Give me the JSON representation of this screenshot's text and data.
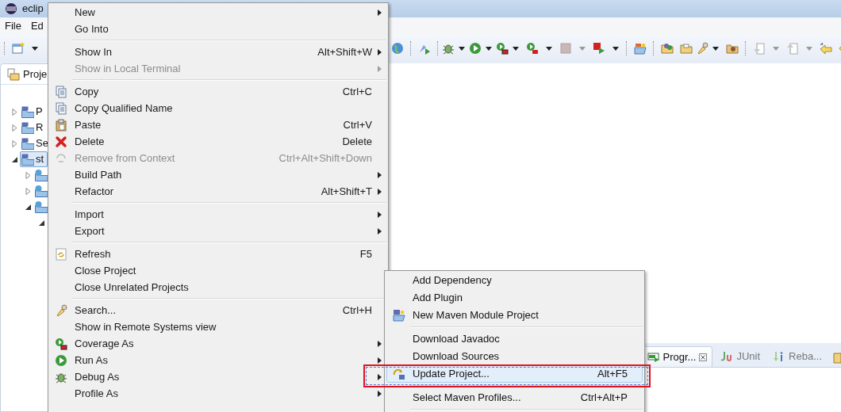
{
  "window": {
    "title": "eclip"
  },
  "menu_bar": [
    "File",
    "Ed"
  ],
  "project_explorer": {
    "tab": "Proje",
    "tree": [
      {
        "label": "P",
        "expanded": false,
        "selected": false
      },
      {
        "label": "R",
        "expanded": false,
        "selected": false
      },
      {
        "label": "Se",
        "expanded": false,
        "selected": false
      },
      {
        "label": "st",
        "expanded": true,
        "selected": true,
        "children": [
          {
            "expanded": false
          },
          {
            "expanded": false
          },
          {
            "expanded": true,
            "children": [
              {
                "expanded": true
              }
            ]
          }
        ]
      }
    ]
  },
  "context_menu": {
    "groups": [
      [
        {
          "label": "New",
          "submenu": true,
          "disabled": false
        },
        {
          "label": "Go Into",
          "submenu": false,
          "disabled": false
        }
      ],
      [
        {
          "label": "Show In",
          "shortcut": "Alt+Shift+W",
          "submenu": true,
          "disabled": false
        },
        {
          "label": "Show in Local Terminal",
          "submenu": true,
          "disabled": true
        }
      ],
      [
        {
          "label": "Copy",
          "shortcut": "Ctrl+C",
          "submenu": false,
          "disabled": false
        },
        {
          "label": "Copy Qualified Name",
          "submenu": false,
          "disabled": false
        },
        {
          "label": "Paste",
          "shortcut": "Ctrl+V",
          "submenu": false,
          "disabled": false
        },
        {
          "label": "Delete",
          "shortcut": "Delete",
          "submenu": false,
          "disabled": false
        },
        {
          "label": "Remove from Context",
          "shortcut": "Ctrl+Alt+Shift+Down",
          "submenu": false,
          "disabled": true
        },
        {
          "label": "Build Path",
          "submenu": true,
          "disabled": false
        },
        {
          "label": "Refactor",
          "shortcut": "Alt+Shift+T",
          "submenu": true,
          "disabled": false
        }
      ],
      [
        {
          "label": "Import",
          "submenu": true,
          "disabled": false
        },
        {
          "label": "Export",
          "submenu": true,
          "disabled": false
        }
      ],
      [
        {
          "label": "Refresh",
          "shortcut": "F5",
          "submenu": false,
          "disabled": false
        },
        {
          "label": "Close Project",
          "submenu": false,
          "disabled": false
        },
        {
          "label": "Close Unrelated Projects",
          "submenu": false,
          "disabled": false
        }
      ],
      [
        {
          "label": "Search...",
          "shortcut": "Ctrl+H",
          "submenu": false,
          "disabled": false
        },
        {
          "label": "Show in Remote Systems view",
          "submenu": false,
          "disabled": false
        },
        {
          "label": "Coverage As",
          "submenu": true,
          "disabled": false
        },
        {
          "label": "Run As",
          "submenu": true,
          "disabled": false
        },
        {
          "label": "Debug As",
          "submenu": true,
          "disabled": false
        },
        {
          "label": "Profile As",
          "submenu": true,
          "disabled": false
        }
      ]
    ]
  },
  "submenu": {
    "groups": [
      [
        {
          "label": "Add Dependency",
          "selected": false
        },
        {
          "label": "Add Plugin",
          "selected": false
        },
        {
          "label": "New Maven Module Project",
          "selected": false
        }
      ],
      [
        {
          "label": "Download Javadoc",
          "selected": false
        },
        {
          "label": "Download Sources",
          "selected": false
        },
        {
          "label": "Update Project...",
          "shortcut": "Alt+F5",
          "selected": true
        }
      ],
      [
        {
          "label": "Select Maven Profiles...",
          "shortcut": "Ctrl+Alt+P",
          "selected": false
        }
      ]
    ]
  },
  "bottom_panel": {
    "tabs": [
      {
        "label": "Progr...",
        "selected": true
      },
      {
        "label": "JUnit",
        "selected": false
      },
      {
        "label": "Reba...",
        "selected": false
      }
    ]
  }
}
